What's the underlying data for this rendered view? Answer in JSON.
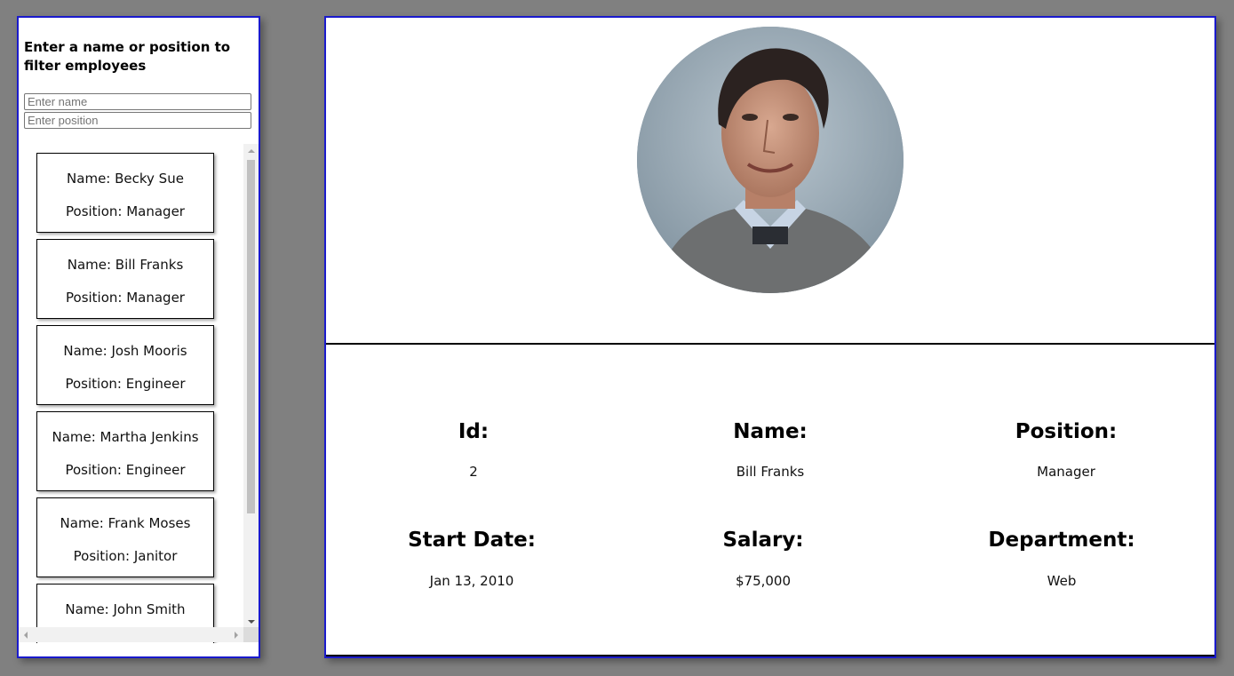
{
  "filter": {
    "heading": "Enter a name or position to filter employees",
    "name_placeholder": "Enter name",
    "position_placeholder": "Enter position"
  },
  "employees": [
    {
      "name": "Name: Becky Sue",
      "position": "Position: Manager"
    },
    {
      "name": "Name: Bill Franks",
      "position": "Position: Manager"
    },
    {
      "name": "Name: Josh Mooris",
      "position": "Position: Engineer"
    },
    {
      "name": "Name: Martha Jenkins",
      "position": "Position: Engineer"
    },
    {
      "name": "Name: Frank Moses",
      "position": "Position: Janitor"
    },
    {
      "name": "Name: John Smith",
      "position": ""
    }
  ],
  "detail": {
    "labels": {
      "id": "Id:",
      "name": "Name:",
      "position": "Position:",
      "start_date": "Start Date:",
      "salary": "Salary:",
      "department": "Department:"
    },
    "values": {
      "id": "2",
      "name": "Bill Franks",
      "position": "Manager",
      "start_date": "Jan 13, 2010",
      "salary": "$75,000",
      "department": "Web"
    }
  },
  "colors": {
    "panel_border": "#1a1acc",
    "background": "#808080"
  }
}
